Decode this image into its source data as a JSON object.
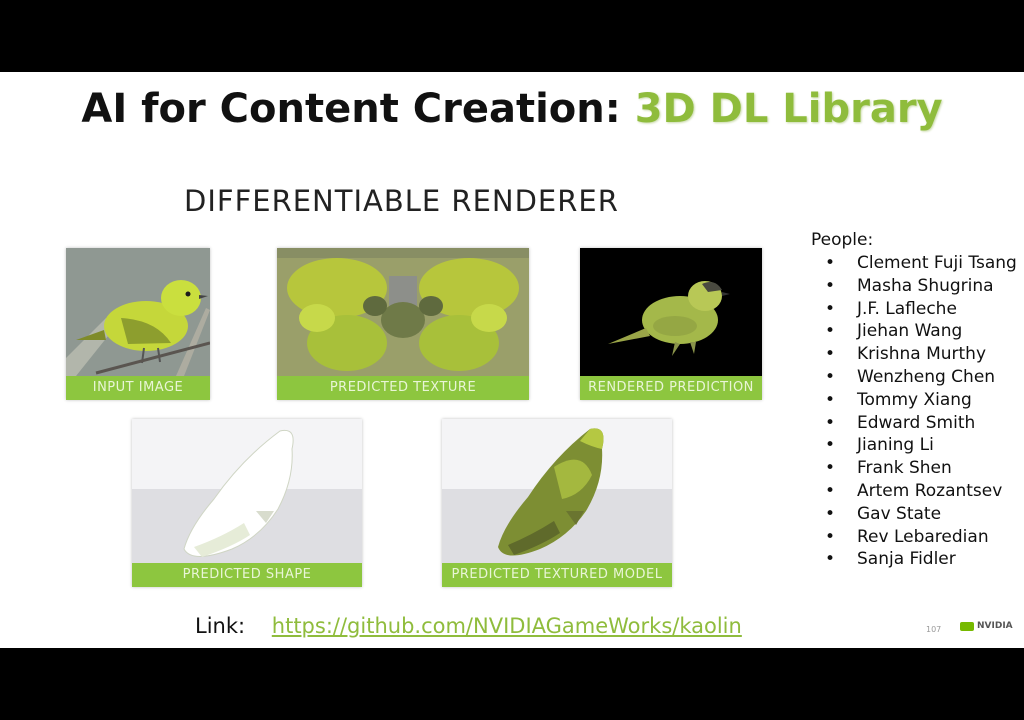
{
  "title": {
    "main": "AI for Content Creation: ",
    "accent": "3D DL Library"
  },
  "subtitle": "DIFFERENTIABLE RENDERER",
  "panels": {
    "input_image": "INPUT IMAGE",
    "predicted_texture": "PREDICTED TEXTURE",
    "rendered_prediction": "RENDERED PREDICTION",
    "predicted_shape": "PREDICTED SHAPE",
    "predicted_textured_model": "PREDICTED TEXTURED MODEL"
  },
  "people": {
    "heading": "People:",
    "bullet": "•",
    "names": [
      "Clement Fuji Tsang",
      "Masha Shugrina",
      "J.F. Lafleche",
      "Jiehan Wang",
      "Krishna Murthy",
      "Wenzheng Chen",
      "Tommy Xiang",
      "Edward Smith",
      "Jianing Li",
      "Frank Shen",
      "Artem Rozantsev",
      "Gav State",
      "Rev Lebaredian",
      "Sanja Fidler"
    ]
  },
  "link": {
    "label": "Link:",
    "url": "https://github.com/NVIDIAGameWorks/kaolin"
  },
  "page_number": "107",
  "logo_text": "NVIDIA",
  "colors": {
    "accent": "#8dc63f",
    "title_accent": "#8fbc3c",
    "background": "#000000"
  }
}
